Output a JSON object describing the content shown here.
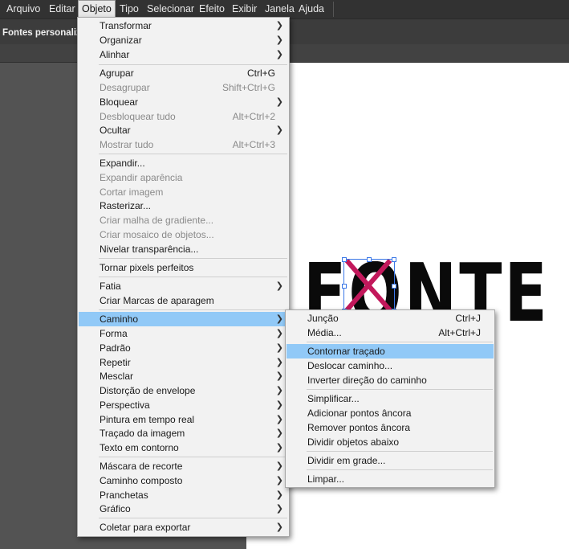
{
  "menubar": {
    "items": [
      "Arquivo",
      "Editar",
      "Objeto",
      "Tipo",
      "Selecionar",
      "Efeito",
      "Exibir",
      "Janela",
      "Ajuda"
    ],
    "active": "Objeto"
  },
  "document": {
    "tab_label": "Fontes personalizadas"
  },
  "canvas": {
    "logo_text": "FONTE",
    "x_color": "#c2185b",
    "selection_color": "#3b78e7"
  },
  "object_menu": {
    "items": [
      {
        "label": "Transformar",
        "shortcut": "",
        "submenu": true,
        "disabled": false
      },
      {
        "label": "Organizar",
        "shortcut": "",
        "submenu": true,
        "disabled": false
      },
      {
        "label": "Alinhar",
        "shortcut": "",
        "submenu": true,
        "disabled": false
      },
      {
        "label": "Agrupar",
        "shortcut": "Ctrl+G",
        "submenu": false,
        "disabled": false
      },
      {
        "label": "Desagrupar",
        "shortcut": "Shift+Ctrl+G",
        "submenu": false,
        "disabled": true
      },
      {
        "label": "Bloquear",
        "shortcut": "",
        "submenu": true,
        "disabled": false
      },
      {
        "label": "Desbloquear tudo",
        "shortcut": "Alt+Ctrl+2",
        "submenu": false,
        "disabled": true
      },
      {
        "label": "Ocultar",
        "shortcut": "",
        "submenu": true,
        "disabled": false
      },
      {
        "label": "Mostrar tudo",
        "shortcut": "Alt+Ctrl+3",
        "submenu": false,
        "disabled": true
      },
      {
        "label": "Expandir...",
        "shortcut": "",
        "submenu": false,
        "disabled": false
      },
      {
        "label": "Expandir aparência",
        "shortcut": "",
        "submenu": false,
        "disabled": true
      },
      {
        "label": "Cortar imagem",
        "shortcut": "",
        "submenu": false,
        "disabled": true
      },
      {
        "label": "Rasterizar...",
        "shortcut": "",
        "submenu": false,
        "disabled": false
      },
      {
        "label": "Criar malha de gradiente...",
        "shortcut": "",
        "submenu": false,
        "disabled": true
      },
      {
        "label": "Criar mosaico de objetos...",
        "shortcut": "",
        "submenu": false,
        "disabled": true
      },
      {
        "label": "Nivelar transparência...",
        "shortcut": "",
        "submenu": false,
        "disabled": false
      },
      {
        "label": "Tornar pixels perfeitos",
        "shortcut": "",
        "submenu": false,
        "disabled": false
      },
      {
        "label": "Fatia",
        "shortcut": "",
        "submenu": true,
        "disabled": false
      },
      {
        "label": "Criar Marcas de aparagem",
        "shortcut": "",
        "submenu": false,
        "disabled": false
      },
      {
        "label": "Caminho",
        "shortcut": "",
        "submenu": true,
        "disabled": false,
        "highlighted": true
      },
      {
        "label": "Forma",
        "shortcut": "",
        "submenu": true,
        "disabled": false
      },
      {
        "label": "Padrão",
        "shortcut": "",
        "submenu": true,
        "disabled": false
      },
      {
        "label": "Repetir",
        "shortcut": "",
        "submenu": true,
        "disabled": false
      },
      {
        "label": "Mesclar",
        "shortcut": "",
        "submenu": true,
        "disabled": false
      },
      {
        "label": "Distorção de envelope",
        "shortcut": "",
        "submenu": true,
        "disabled": false
      },
      {
        "label": "Perspectiva",
        "shortcut": "",
        "submenu": true,
        "disabled": false
      },
      {
        "label": "Pintura em tempo real",
        "shortcut": "",
        "submenu": true,
        "disabled": false
      },
      {
        "label": "Traçado da imagem",
        "shortcut": "",
        "submenu": true,
        "disabled": false
      },
      {
        "label": "Texto em contorno",
        "shortcut": "",
        "submenu": true,
        "disabled": false
      },
      {
        "label": "Máscara de recorte",
        "shortcut": "",
        "submenu": true,
        "disabled": false
      },
      {
        "label": "Caminho composto",
        "shortcut": "",
        "submenu": true,
        "disabled": false
      },
      {
        "label": "Pranchetas",
        "shortcut": "",
        "submenu": true,
        "disabled": false
      },
      {
        "label": "Gráfico",
        "shortcut": "",
        "submenu": true,
        "disabled": false
      },
      {
        "label": "Coletar para exportar",
        "shortcut": "",
        "submenu": true,
        "disabled": false
      }
    ]
  },
  "path_submenu": {
    "items": [
      {
        "label": "Junção",
        "shortcut": "Ctrl+J"
      },
      {
        "label": "Média...",
        "shortcut": "Alt+Ctrl+J"
      },
      {
        "label": "Contornar traçado",
        "shortcut": "",
        "highlighted": true
      },
      {
        "label": "Deslocar caminho...",
        "shortcut": ""
      },
      {
        "label": "Inverter direção do caminho",
        "shortcut": ""
      },
      {
        "label": "Simplificar...",
        "shortcut": ""
      },
      {
        "label": "Adicionar pontos âncora",
        "shortcut": ""
      },
      {
        "label": "Remover pontos âncora",
        "shortcut": ""
      },
      {
        "label": "Dividir objetos abaixo",
        "shortcut": ""
      },
      {
        "label": "Dividir em grade...",
        "shortcut": ""
      },
      {
        "label": "Limpar...",
        "shortcut": ""
      }
    ]
  }
}
